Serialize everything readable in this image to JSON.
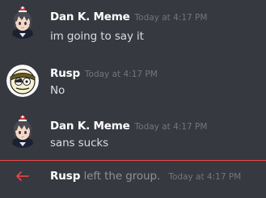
{
  "messages": [
    {
      "author": "Dan K. Meme",
      "timestamp": "Today at 4:17 PM",
      "text": "im going to say it",
      "avatar_icon": "anime-character-avatar-icon"
    },
    {
      "author": "Rusp",
      "timestamp": "Today at 4:17 PM",
      "text": "No",
      "avatar_icon": "cartoon-face-avatar-icon"
    },
    {
      "author": "Dan K. Meme",
      "timestamp": "Today at 4:17 PM",
      "text": "sans sucks",
      "avatar_icon": "anime-character-avatar-icon"
    }
  ],
  "system_message": {
    "author": "Rusp",
    "action": "left the group.",
    "timestamp": "Today at 4:17 PM",
    "icon": "leave-arrow-icon"
  },
  "colors": {
    "background": "#36393f",
    "author": "#ffffff",
    "timestamp": "#72767d",
    "message_text": "#dcddde",
    "divider": "#f04747",
    "leave_arrow": "#f04747"
  }
}
